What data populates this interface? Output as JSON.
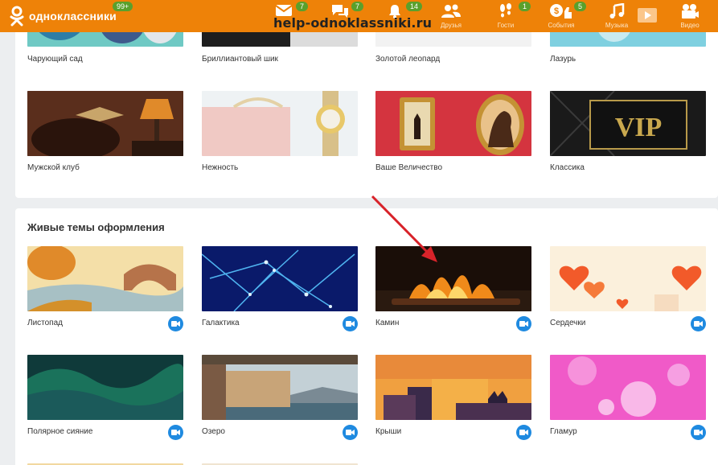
{
  "header": {
    "logo_text": "одноклассники",
    "logo_badge": "99+",
    "watermark": "help-odnoklassniki.ru",
    "nav": [
      {
        "label": "",
        "badge": "",
        "icon": "mail-icon"
      },
      {
        "label": "",
        "badge": "7",
        "icon": "discussions-icon"
      },
      {
        "label": "",
        "badge": "14",
        "icon": "notifications-icon"
      },
      {
        "label": "Друзья",
        "badge": "",
        "icon": "friends-icon"
      },
      {
        "label": "Гости",
        "badge": "1",
        "icon": "guests-icon"
      },
      {
        "label": "События",
        "badge": "5",
        "icon": "events-icon"
      },
      {
        "label": "Музыка",
        "badge": "",
        "icon": "music-icon"
      },
      {
        "label": "",
        "badge": "",
        "icon": "video-play-icon"
      },
      {
        "label": "Видео",
        "badge": "",
        "icon": "video-camera-icon"
      }
    ]
  },
  "top_themes": [
    {
      "label": "Чарующий сад"
    },
    {
      "label": "Бриллиантовый шик"
    },
    {
      "label": "Золотой леопард"
    },
    {
      "label": "Лазурь"
    },
    {
      "label": "Мужской клуб"
    },
    {
      "label": "Нежность"
    },
    {
      "label": "Ваше Величество"
    },
    {
      "label": "Классика"
    }
  ],
  "live_section": {
    "title": "Живые темы оформления",
    "themes": [
      {
        "label": "Листопад"
      },
      {
        "label": "Галактика"
      },
      {
        "label": "Камин"
      },
      {
        "label": "Сердечки"
      },
      {
        "label": "Полярное сияние"
      },
      {
        "label": "Озеро"
      },
      {
        "label": "Крыши"
      },
      {
        "label": "Гламур"
      }
    ]
  },
  "colors": {
    "header_orange": "#ee8208",
    "badge_green": "#5aa02c",
    "video_button_blue": "#1f8ae0",
    "arrow_red": "#d8232a"
  }
}
